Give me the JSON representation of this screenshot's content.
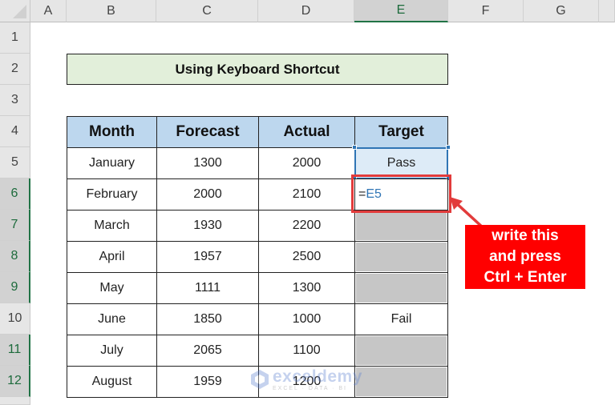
{
  "spreadsheet": {
    "columns": [
      "A",
      "B",
      "C",
      "D",
      "E",
      "F",
      "G"
    ],
    "active_column": "E",
    "rows": [
      "1",
      "2",
      "3",
      "4",
      "5",
      "6",
      "7",
      "8",
      "9",
      "10",
      "11",
      "12"
    ],
    "active_rows": [
      "6",
      "7",
      "8",
      "9",
      "11",
      "12"
    ],
    "title": "Using Keyboard Shortcut",
    "table": {
      "headers": [
        "Month",
        "Forecast",
        "Actual",
        "Target"
      ],
      "rows": [
        {
          "month": "January",
          "forecast": "1300",
          "actual": "2000",
          "target": "Pass",
          "state": "selected"
        },
        {
          "month": "February",
          "forecast": "2000",
          "actual": "2100",
          "target": "",
          "state": "editing"
        },
        {
          "month": "March",
          "forecast": "1930",
          "actual": "2200",
          "target": "",
          "state": "gray"
        },
        {
          "month": "April",
          "forecast": "1957",
          "actual": "2500",
          "target": "",
          "state": "gray"
        },
        {
          "month": "May",
          "forecast": "1111",
          "actual": "1300",
          "target": "",
          "state": "gray"
        },
        {
          "month": "June",
          "forecast": "1850",
          "actual": "1000",
          "target": "Fail",
          "state": "normal"
        },
        {
          "month": "July",
          "forecast": "2065",
          "actual": "1100",
          "target": "",
          "state": "gray"
        },
        {
          "month": "August",
          "forecast": "1959",
          "actual": "1200",
          "target": "",
          "state": "gray"
        }
      ]
    },
    "editing_cell": {
      "address": "E6",
      "formula_prefix": "=",
      "formula_ref": "E5"
    }
  },
  "annotation": {
    "callout_lines": [
      "write this",
      "and press",
      "Ctrl + Enter"
    ],
    "color": "#ff0000"
  },
  "watermark": {
    "name": "exceldemy",
    "tagline": "EXCEL · DATA · BI"
  }
}
